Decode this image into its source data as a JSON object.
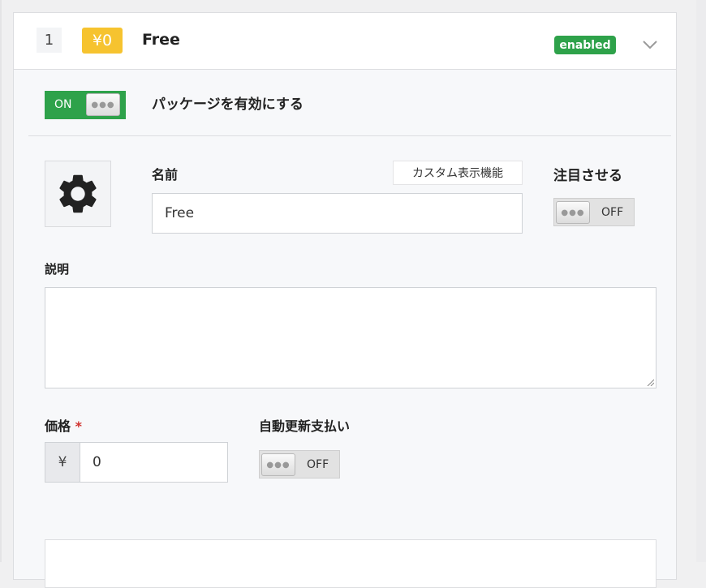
{
  "header": {
    "number": "1",
    "price_badge": "¥0",
    "title": "Free",
    "status": "enabled"
  },
  "enable_package": {
    "toggle_state": "ON",
    "label": "パッケージを有効にする"
  },
  "name_field": {
    "label": "名前",
    "value": "Free",
    "custom_display_button": "カスタム表示機能"
  },
  "featured": {
    "label": "注目させる",
    "toggle_state": "OFF"
  },
  "description": {
    "label": "説明",
    "value": ""
  },
  "price": {
    "label": "価格",
    "required_mark": "*",
    "currency": "¥",
    "value": "0"
  },
  "auto_renew": {
    "label": "自動更新支払い",
    "toggle_state": "OFF"
  },
  "icons": {
    "package_icon": "gear-icon",
    "expand": "chevron-down-icon"
  },
  "colors": {
    "status_green": "#2ea24a",
    "price_badge_yellow": "#f6c32f",
    "required_red": "#d0312d"
  }
}
